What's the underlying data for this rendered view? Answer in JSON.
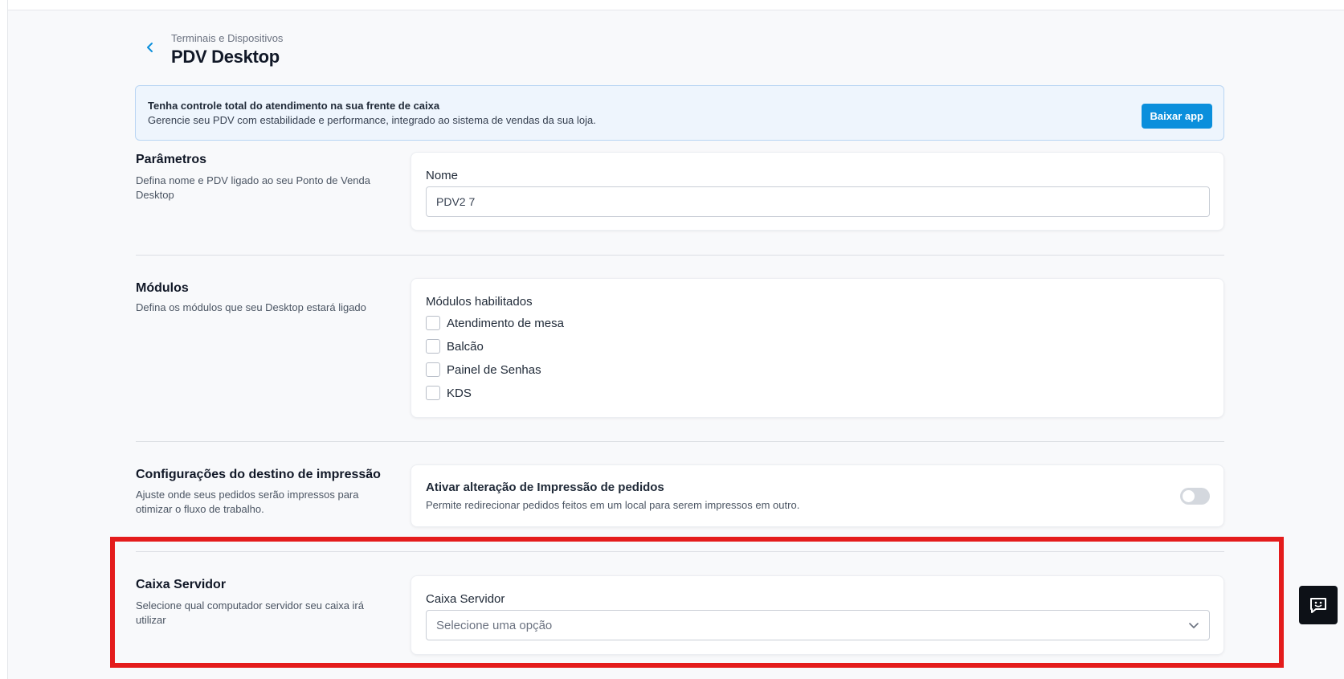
{
  "header": {
    "breadcrumb": "Terminais e Dispositivos",
    "title": "PDV Desktop"
  },
  "banner": {
    "title": "Tenha controle total do atendimento na sua frente de caixa",
    "text": "Gerencie seu PDV com estabilidade e performance, integrado ao sistema de vendas da sua loja.",
    "button_label": "Baixar app"
  },
  "sections": {
    "parametros": {
      "title": "Parâmetros",
      "description": "Defina nome e PDV ligado ao seu Ponto de Venda Desktop",
      "field_label": "Nome",
      "field_value": "PDV2 7"
    },
    "modulos": {
      "title": "Módulos",
      "description": "Defina os módulos que seu Desktop estará ligado",
      "group_label": "Módulos habilitados",
      "options": [
        {
          "label": "Atendimento de mesa",
          "checked": false
        },
        {
          "label": "Balcão",
          "checked": false
        },
        {
          "label": "Painel de Senhas",
          "checked": false
        },
        {
          "label": "KDS",
          "checked": false
        }
      ]
    },
    "impressao": {
      "title": "Configurações do destino de impressão",
      "description": "Ajuste onde seus pedidos serão impressos para otimizar o fluxo de trabalho.",
      "toggle_title": "Ativar alteração de Impressão de pedidos",
      "toggle_description": "Permite redirecionar pedidos feitos em um local para serem impressos em outro.",
      "toggle_on": false
    },
    "caixa_servidor": {
      "title": "Caixa Servidor",
      "description": "Selecione qual computador servidor seu caixa irá utilizar",
      "field_label": "Caixa Servidor",
      "placeholder": "Selecione uma opção"
    }
  },
  "colors": {
    "accent": "#0b8fdc",
    "highlight": "#e41c1c",
    "chat_button": "#0d1117"
  },
  "icons": {
    "back": "chevron-left-icon",
    "select": "chevron-down-icon",
    "chat": "chat-support-icon"
  }
}
